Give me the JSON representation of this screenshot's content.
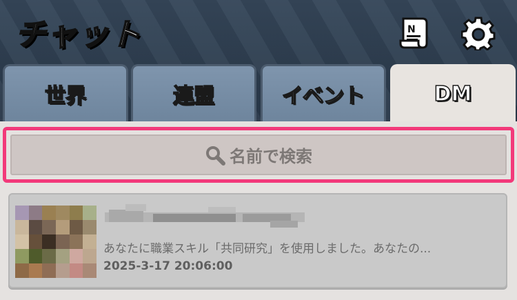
{
  "header": {
    "title": "チャット",
    "icons": [
      "notice-board-icon",
      "gear-icon"
    ]
  },
  "tabs": [
    {
      "label": "世界",
      "active": false
    },
    {
      "label": "連盟",
      "active": false
    },
    {
      "label": "イベント",
      "active": false
    },
    {
      "label": "DM",
      "active": true
    }
  ],
  "search": {
    "placeholder": "名前で検索",
    "icon": "search-icon",
    "highlight_color": "#f2397a"
  },
  "dm_list": [
    {
      "name": "",
      "preview": "あなたに職業スキル「共同研究」を使用しました。あなたの...",
      "timestamp": "2025-3-17 20:06:00"
    }
  ]
}
